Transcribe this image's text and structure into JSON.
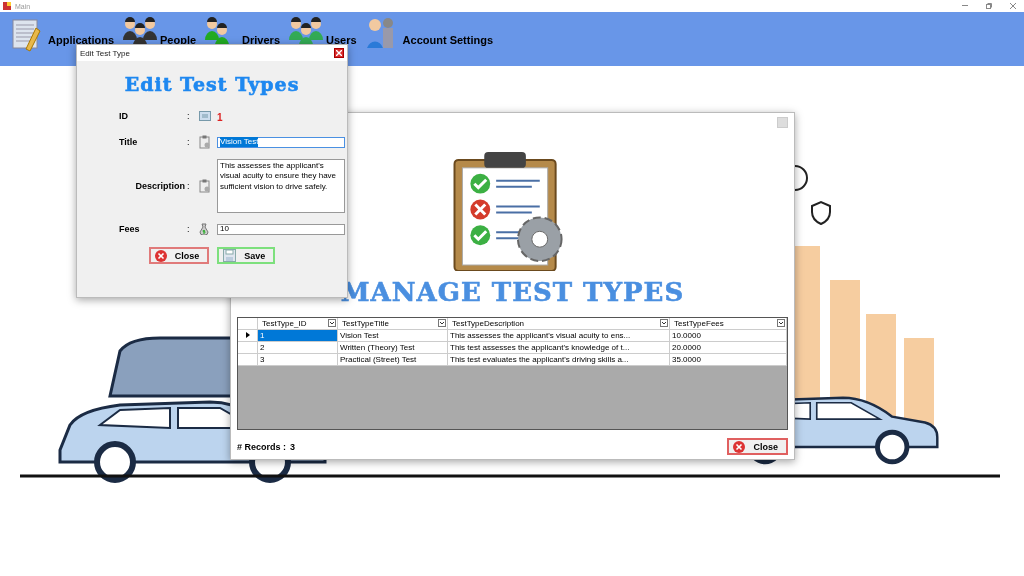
{
  "window": {
    "title": "Main"
  },
  "menu": {
    "items": [
      {
        "label": "Applications",
        "kind": "applications"
      },
      {
        "label": "People",
        "kind": "people"
      },
      {
        "label": "Drivers",
        "kind": "drivers"
      },
      {
        "label": "Users",
        "kind": "users"
      },
      {
        "label": "Account Settings",
        "kind": "settings"
      }
    ]
  },
  "manage_dialog": {
    "heading": "MANAGE TEST TYPES",
    "table": {
      "columns": [
        "TestType_ID",
        "TestTypeTitle",
        "TestTypeDescription",
        "TestTypeFees"
      ],
      "rows": [
        {
          "selected": true,
          "cells": [
            "1",
            "Vision Test",
            "This assesses the applicant's visual acuity to ens...",
            "10.0000"
          ]
        },
        {
          "selected": false,
          "cells": [
            "2",
            "Written (Theory) Test",
            "This test assesses the applicant's knowledge of t...",
            "20.0000"
          ]
        },
        {
          "selected": false,
          "cells": [
            "3",
            "Practical (Street) Test",
            "This test evaluates the applicant's driving skills a...",
            "35.0000"
          ]
        }
      ]
    },
    "records_label": "# Records :",
    "records_count": "3",
    "close_button": "Close"
  },
  "edit_dialog": {
    "title": "Edit Test Type",
    "heading": "Edit Test Types",
    "fields": [
      {
        "label": "ID",
        "separator": ":",
        "kind": "readout",
        "value": "1",
        "selected": false
      },
      {
        "label": "Title",
        "separator": ":",
        "kind": "text",
        "value": "Vision Test",
        "selected": true
      },
      {
        "label": "Description",
        "separator": ":",
        "kind": "multiline",
        "value": "This assesses the applicant's visual acuity to ensure they have sufficient vision to drive safely.",
        "selected": false
      },
      {
        "label": "Fees",
        "separator": ":",
        "kind": "money",
        "value": "10",
        "selected": false
      }
    ],
    "buttons": [
      {
        "label": "Close",
        "kind": "close"
      },
      {
        "label": "Save",
        "kind": "save"
      }
    ]
  }
}
